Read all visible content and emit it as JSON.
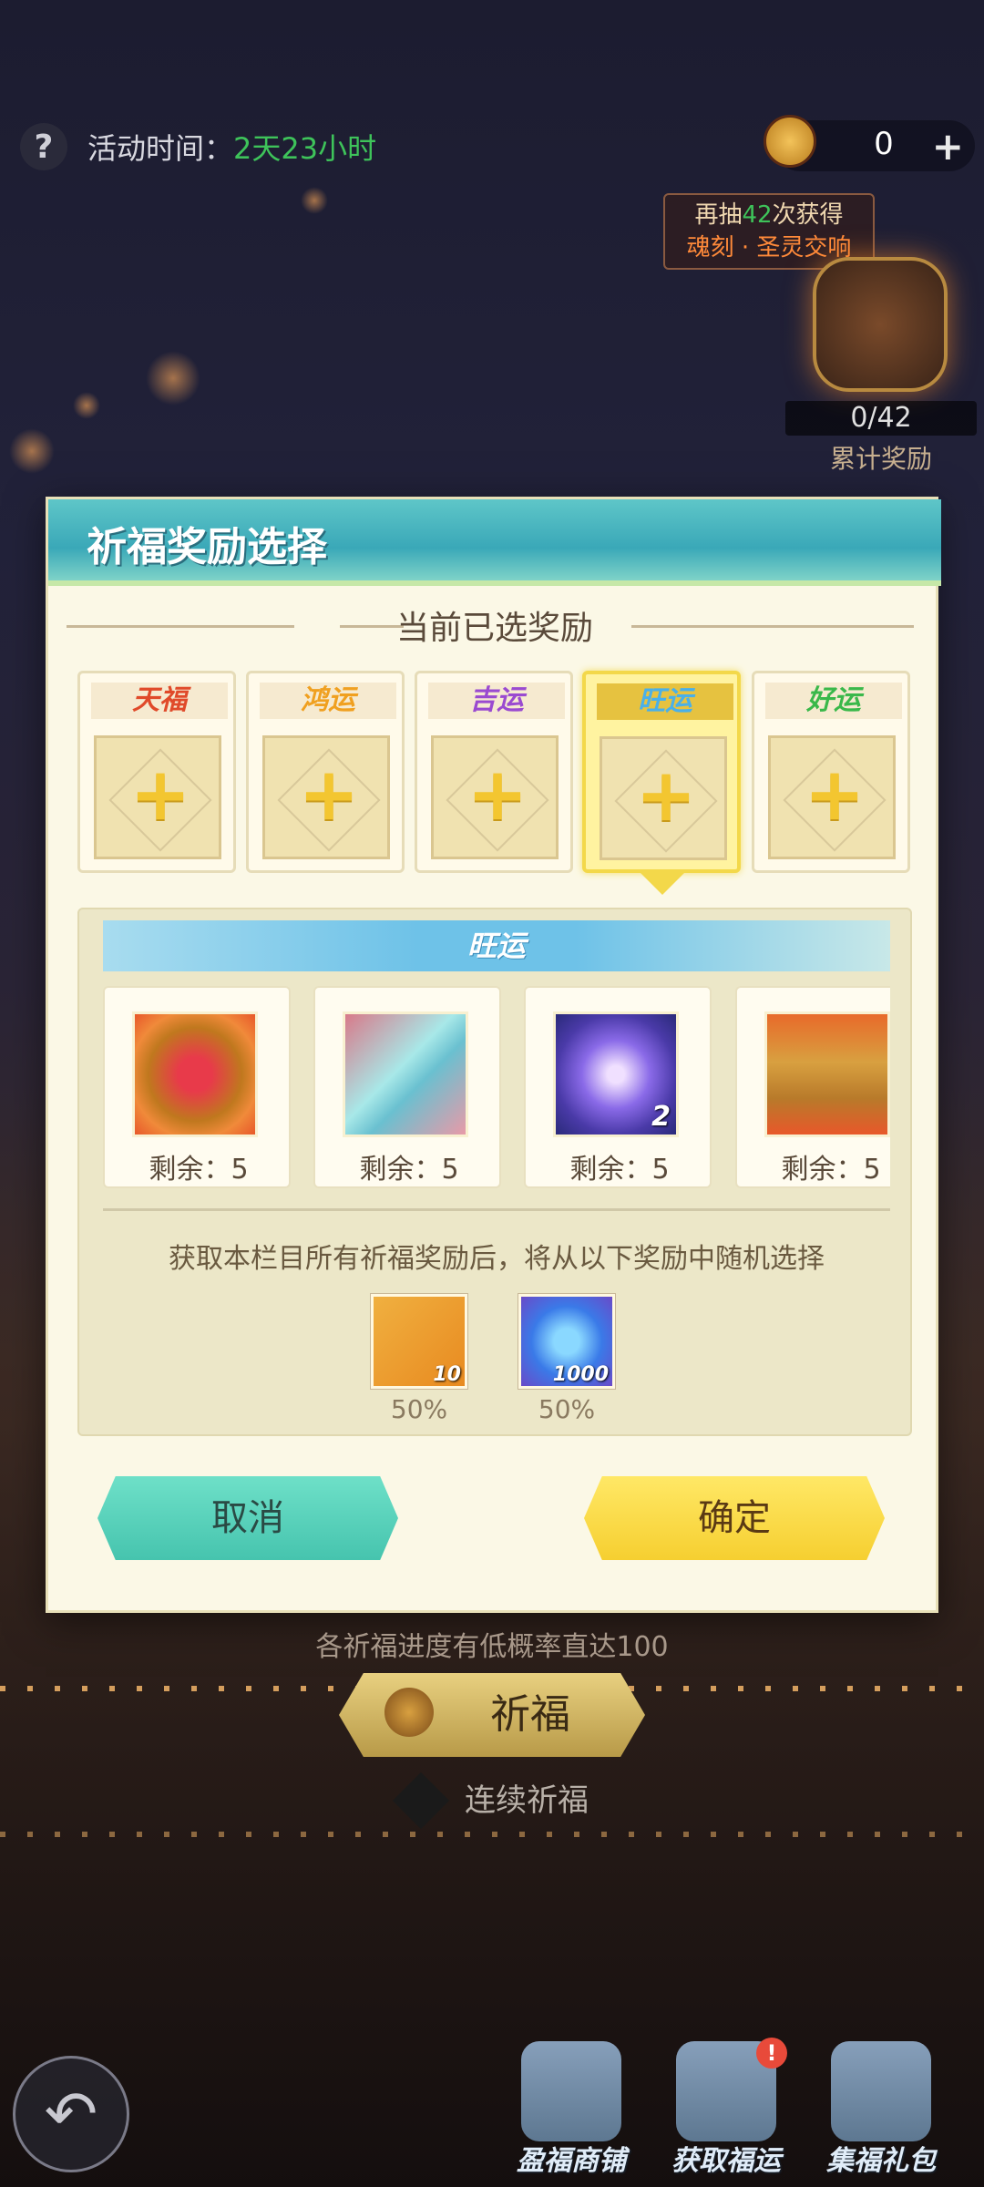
{
  "topbar": {
    "help_icon": "question-icon",
    "time_label": "活动时间：",
    "time_value": "2天23小时",
    "currency_value": "0",
    "plus_label": "+"
  },
  "draw_tip": {
    "prefix": "再抽",
    "count": "42",
    "suffix": "次获得",
    "reward_name": "魂刻 · 圣灵交响"
  },
  "cumulative": {
    "progress": "0/42",
    "label": "累计奖励"
  },
  "modal": {
    "title": "祈福奖励选择",
    "section_title": "当前已选奖励",
    "slots": [
      {
        "label": "天福",
        "color": "#e04a2a",
        "active": false
      },
      {
        "label": "鸿运",
        "color": "#f0a020",
        "active": false
      },
      {
        "label": "吉运",
        "color": "#9a4ad0",
        "active": false
      },
      {
        "label": "旺运",
        "color": "#4ab0e8",
        "active": true
      },
      {
        "label": "好运",
        "color": "#3ab84a",
        "active": false
      }
    ],
    "pool": {
      "title": "旺运",
      "rewards": [
        {
          "icon": "red-orb-icon",
          "remain": "剩余：5",
          "count": ""
        },
        {
          "icon": "crystal-blade-icon",
          "remain": "剩余：5",
          "count": ""
        },
        {
          "icon": "rune-orb-icon",
          "remain": "剩余：5",
          "count": "2"
        },
        {
          "icon": "treasure-chest-icon",
          "remain": "剩余：5",
          "count": ""
        }
      ],
      "note": "获取本栏目所有祈福奖励后，将从以下奖励中随机选择",
      "bonus": [
        {
          "icon": "black-stone-icon",
          "count": "10",
          "pct": "50%"
        },
        {
          "icon": "blue-potion-icon",
          "count": "1000",
          "pct": "50%"
        }
      ]
    },
    "cancel_label": "取消",
    "confirm_label": "确定"
  },
  "below": {
    "prob_note": "各祈福进度有低概率直达100",
    "pray_label": "祈福",
    "continuous_label": "连续祈福"
  },
  "bottom_nav": [
    {
      "label": "盈福商铺",
      "icon": "shop-chest-icon",
      "badge": ""
    },
    {
      "label": "获取福运",
      "icon": "scroll-book-icon",
      "badge": "!"
    },
    {
      "label": "集福礼包",
      "icon": "gift-box-icon",
      "badge": ""
    }
  ]
}
